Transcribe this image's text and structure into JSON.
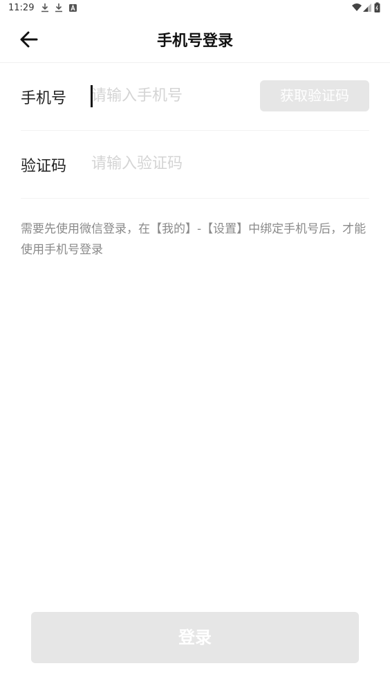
{
  "status_bar": {
    "time": "11:29",
    "icons": [
      "download-icon",
      "download-icon",
      "a-icon",
      "wifi-icon",
      "signal-icon",
      "battery-icon"
    ]
  },
  "header": {
    "title": "手机号登录",
    "back_icon": "arrow-left-icon"
  },
  "form": {
    "phone": {
      "label": "手机号",
      "placeholder": "请输入手机号",
      "value": ""
    },
    "get_code_label": "获取验证码",
    "code": {
      "label": "验证码",
      "placeholder": "请输入验证码",
      "value": ""
    }
  },
  "hint": "需要先使用微信登录，在【我的】-【设置】中绑定手机号后，才能使用手机号登录",
  "login_label": "登录",
  "colors": {
    "disabled_button": "#e6e6e6",
    "placeholder": "#d4d4d4",
    "hint_text": "#8a8a8a"
  }
}
